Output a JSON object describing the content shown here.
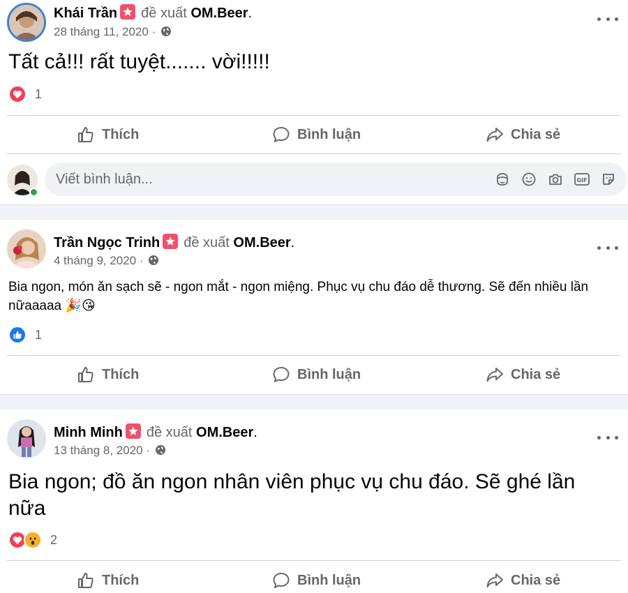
{
  "posts": [
    {
      "author": "Khái Trần",
      "recommends": "đề xuất",
      "page": "OM.Beer",
      "date": "28 tháng 11, 2020",
      "meta_sep": "·",
      "text": "Tất cả!!! rất tuyệt....... vời!!!!!",
      "reaction_count": "1",
      "reactions": [
        "heart-reaction"
      ]
    },
    {
      "author": "Trần Ngọc Trinh",
      "recommends": "đề xuất",
      "page": "OM.Beer",
      "date": "4 tháng 9, 2020",
      "meta_sep": "·",
      "text": "Bia ngon, món ăn sạch sẽ - ngon mắt - ngon miệng. Phục vụ chu đáo dễ thương. Sẽ đến nhiều lần nữaaaaa 🎉😘",
      "reaction_count": "1",
      "reactions": [
        "like-reaction"
      ]
    },
    {
      "author": "Minh Minh",
      "recommends": "đề xuất",
      "page": "OM.Beer",
      "date": "13 tháng 8, 2020",
      "meta_sep": "·",
      "text": "Bia ngon; đồ ăn ngon nhân viên phục vụ chu đáo. Sẽ ghé lần nữa",
      "reaction_count": "2",
      "reactions": [
        "heart-reaction",
        "wow-reaction"
      ]
    }
  ],
  "actions": {
    "like": "Thích",
    "comment": "Bình luận",
    "share": "Chia sẻ"
  },
  "composer": {
    "placeholder": "Viết bình luận..."
  },
  "colors": {
    "text_secondary": "#65676b",
    "badge": "#f0506e",
    "like_blue": "#1877f2",
    "heart_red": "#f33e58",
    "online_green": "#31a24c",
    "separator": "#f0f2f5"
  }
}
